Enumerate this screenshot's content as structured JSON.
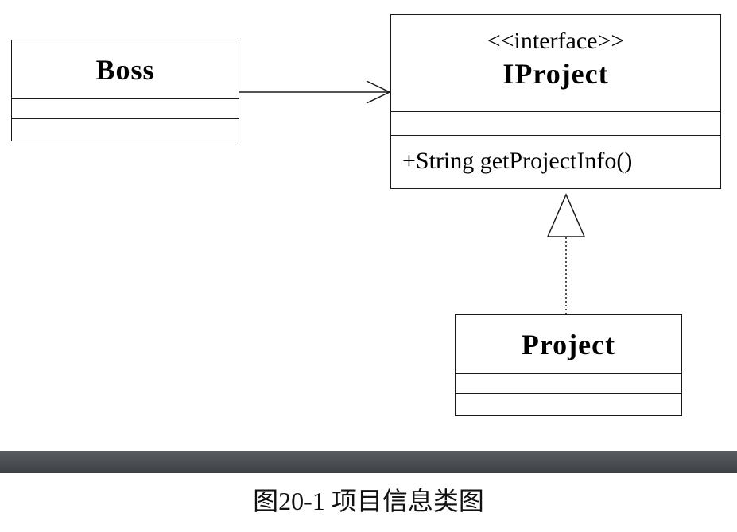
{
  "diagram": {
    "classes": {
      "boss": {
        "name": "Boss"
      },
      "iproject": {
        "stereotype": "<<interface>>",
        "name": "IProject",
        "operations": [
          "+String getProjectInfo()"
        ]
      },
      "project": {
        "name": "Project"
      }
    },
    "relations": [
      {
        "from": "Boss",
        "to": "IProject",
        "type": "association"
      },
      {
        "from": "Project",
        "to": "IProject",
        "type": "realization"
      }
    ],
    "colors": {
      "line": "#1a1a1a",
      "bar": "#4a4c51"
    }
  },
  "caption": "图20-1 项目信息类图"
}
